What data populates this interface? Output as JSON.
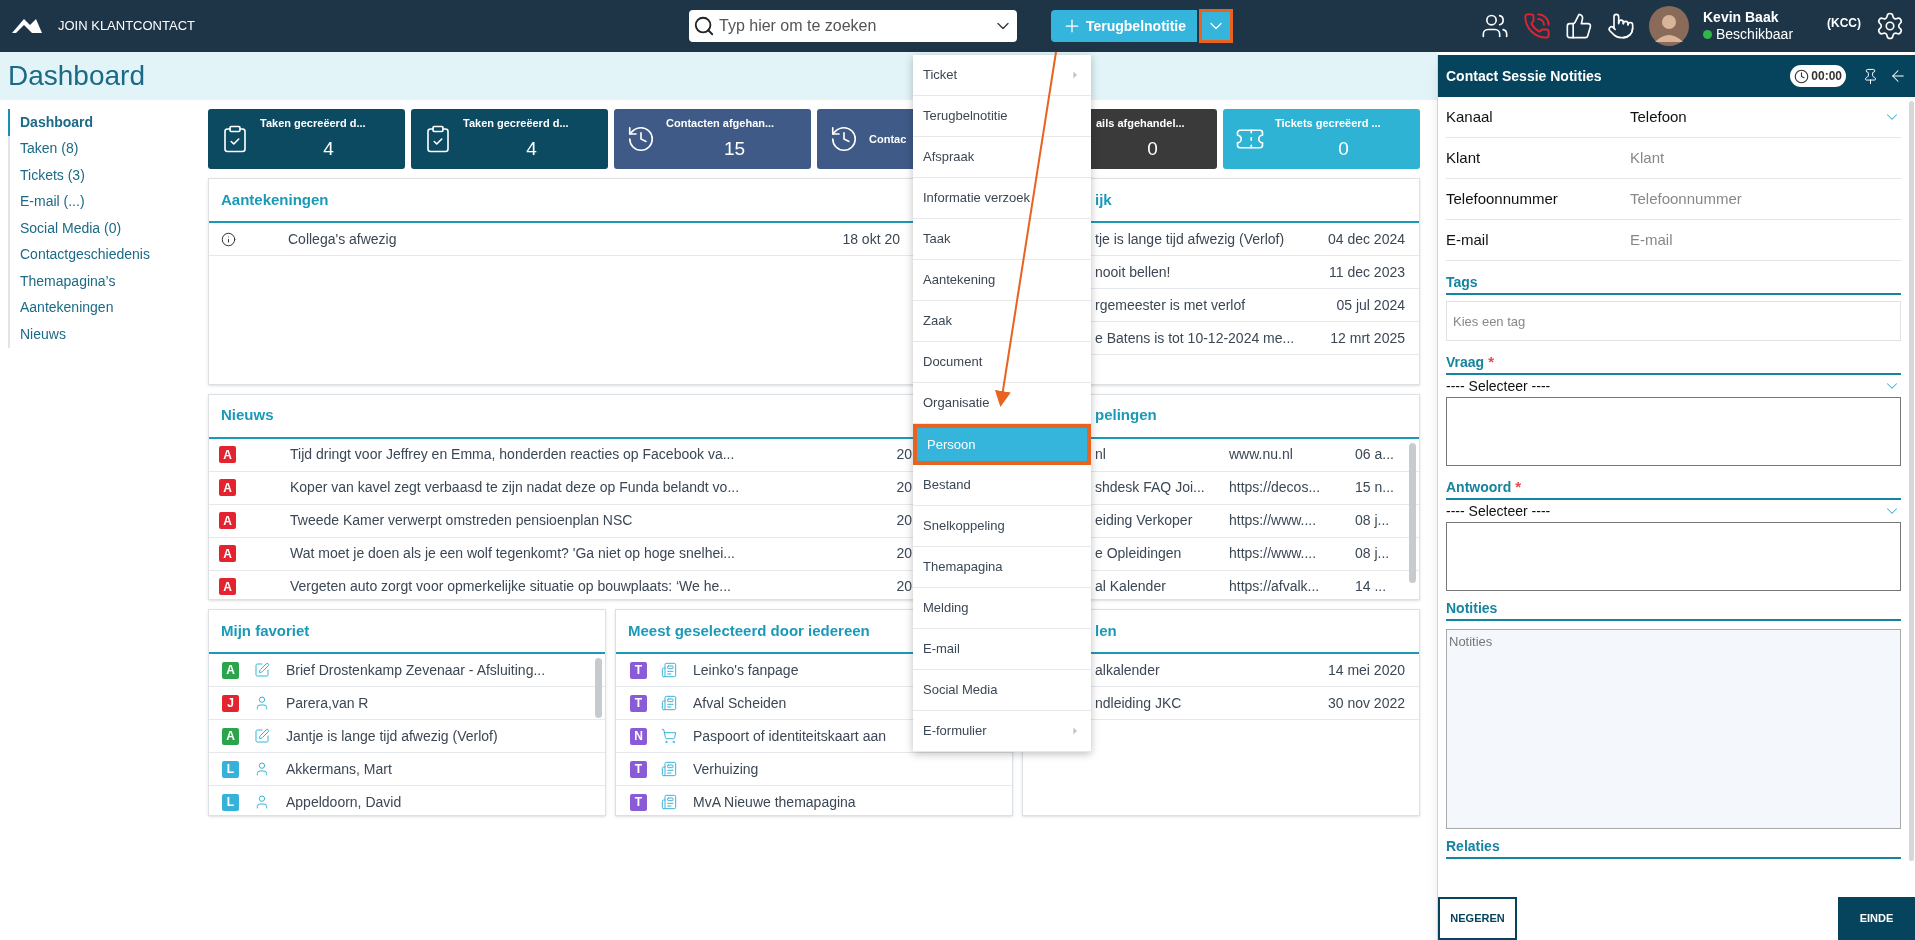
{
  "app": {
    "title": "JOIN KLANTCONTACT"
  },
  "search": {
    "placeholder": "Typ hier om te zoeken"
  },
  "new_button": {
    "label": "Terugbelnotitie",
    "expanded": true
  },
  "user": {
    "name": "Kevin Baak",
    "status": "Beschikbaar",
    "available": true,
    "role": "(KCC)"
  },
  "page_title": "Dashboard",
  "nav": [
    {
      "label": "Dashboard",
      "selected": true
    },
    {
      "label": "Taken (8)",
      "selected": false
    },
    {
      "label": "Tickets (3)",
      "selected": false
    },
    {
      "label": "E-mail (...)",
      "selected": false
    },
    {
      "label": "Social Media (0)",
      "selected": false
    },
    {
      "label": "Contactgeschiedenis",
      "selected": false
    },
    {
      "label": "Themapagina’s",
      "selected": false
    },
    {
      "label": "Aantekeningen",
      "selected": false
    },
    {
      "label": "Nieuws",
      "selected": false
    }
  ],
  "stats": [
    {
      "title": "Taken gecreëerd d...",
      "value": "4",
      "kind": "task",
      "color": "#0c4a62"
    },
    {
      "title": "Taken gecreëerd d...",
      "value": "4",
      "kind": "task",
      "color": "#0c4a62"
    },
    {
      "title": "Contacten afgehan...",
      "value": "15",
      "kind": "contact",
      "color": "#3f5a86"
    },
    {
      "title": "Contac",
      "kind": "contact",
      "color": "#3f5a86"
    },
    {
      "title": "ails afgehandel...",
      "value": "0",
      "color": "#3a3a3a"
    },
    {
      "title": "Tickets gecreëerd ...",
      "value": "0",
      "kind": "ticket",
      "color": "#2fb3d4"
    }
  ],
  "notes_panel": {
    "title": "Aantekeningen",
    "rows": [
      {
        "text": "Collega's afwezig",
        "date": "18 okt 20"
      }
    ]
  },
  "news_panel": {
    "title": "Nieuws",
    "rows": [
      {
        "badge": "A",
        "color": "#e3242f",
        "text": "Tijd dringt voor Jeffrey en Emma, honderden reacties op Facebook va...",
        "date": "20"
      },
      {
        "badge": "A",
        "color": "#e3242f",
        "text": "Koper van kavel zegt verbaasd te zijn nadat deze op Funda belandt vo...",
        "date": "20"
      },
      {
        "badge": "A",
        "color": "#e3242f",
        "text": "Tweede Kamer verwerpt omstreden pensioenplan NSC",
        "date": "20"
      },
      {
        "badge": "A",
        "color": "#e3242f",
        "text": "Wat moet je doen als je een wolf tegenkomt? 'Ga niet op hoge snelhei...",
        "date": "20"
      },
      {
        "badge": "A",
        "color": "#e3242f",
        "text": "Vergeten auto zorgt voor opmerkelijke situatie op bouwplaats: ‘We he...",
        "date": "20"
      }
    ]
  },
  "favorites_panel": {
    "title": "Mijn favoriet",
    "rows": [
      {
        "badge": "A",
        "color": "#2ca44c",
        "kind": "note",
        "text": "Brief Drostenkamp Zevenaar - Afsluiting..."
      },
      {
        "badge": "J",
        "color": "#e3242f",
        "kind": "person",
        "text": "Parera,van R"
      },
      {
        "badge": "A",
        "color": "#2ca44c",
        "kind": "note",
        "text": "Jantje is lange tijd afwezig (Verlof)"
      },
      {
        "badge": "L",
        "color": "#36b2d9",
        "kind": "person",
        "text": "Akkermans, Mart"
      },
      {
        "badge": "L",
        "color": "#36b2d9",
        "kind": "person",
        "text": "Appeldoorn, David"
      }
    ]
  },
  "popular_panel": {
    "title": "Meest geselecteerd door iedereen",
    "rows": [
      {
        "badge": "T",
        "color": "#8a5bd6",
        "kind": "page",
        "text": "Leinko's fanpage"
      },
      {
        "badge": "T",
        "color": "#8a5bd6",
        "kind": "page",
        "text": "Afval Scheiden"
      },
      {
        "badge": "N",
        "color": "#8a5bd6",
        "kind": "product",
        "text": "Paspoort of identiteitskaart aan"
      },
      {
        "badge": "T",
        "color": "#8a5bd6",
        "kind": "page",
        "text": "Verhuizing"
      },
      {
        "badge": "T",
        "color": "#8a5bd6",
        "kind": "page",
        "text": "MvA Nieuwe themapagina"
      }
    ]
  },
  "column_3_top": {
    "title": "ijk",
    "rows": [
      {
        "text": "tje is lange tijd afwezig (Verlof)",
        "date": "04 dec 2024"
      },
      {
        "text": "nooit bellen!",
        "date": "11 dec 2023"
      },
      {
        "text": "rgemeester is met verlof",
        "date": "05 jul 2024"
      },
      {
        "text": "e Batens is tot 10-12-2024 me...",
        "date": "12 mrt 2025"
      }
    ]
  },
  "column_3_middle": {
    "title": "pelingen",
    "rows": [
      {
        "text": "nl",
        "url": "www.nu.nl",
        "date": "06 a..."
      },
      {
        "text": "shdesk FAQ Joi...",
        "url": "https://decos...",
        "date": "15 n..."
      },
      {
        "text": "eiding Verkoper",
        "url": "https://www....",
        "date": "08 j..."
      },
      {
        "text": "e Opleidingen",
        "url": "https://www....",
        "date": "08 j..."
      },
      {
        "text": "al Kalender",
        "url": "https://afvalk...",
        "date": "14 ..."
      }
    ]
  },
  "column_3_bottom": {
    "title": "len",
    "rows": [
      {
        "text": "alkalender",
        "date": "14 mei 2020"
      },
      {
        "text": "ndleiding JKC",
        "date": "30 nov 2022"
      }
    ]
  },
  "menu": {
    "items": [
      {
        "label": "Ticket",
        "selected": false,
        "submenu": true
      },
      {
        "label": "Terugbelnotitie",
        "selected": false,
        "submenu": false
      },
      {
        "label": "Afspraak",
        "selected": false,
        "submenu": false
      },
      {
        "label": "Informatie verzoek",
        "selected": false,
        "submenu": false
      },
      {
        "label": "Taak",
        "selected": false,
        "submenu": false
      },
      {
        "label": "Aantekening",
        "selected": false,
        "submenu": false
      },
      {
        "label": "Zaak",
        "selected": false,
        "submenu": false
      },
      {
        "label": "Document",
        "selected": false,
        "submenu": false
      },
      {
        "label": "Organisatie",
        "selected": false,
        "submenu": false
      },
      {
        "label": "Persoon",
        "selected": true,
        "submenu": false
      },
      {
        "label": "Bestand",
        "selected": false,
        "submenu": false
      },
      {
        "label": "Snelkoppeling",
        "selected": false,
        "submenu": false
      },
      {
        "label": "Themapagina",
        "selected": false,
        "submenu": false
      },
      {
        "label": "Melding",
        "selected": false,
        "submenu": false
      },
      {
        "label": "E-mail",
        "selected": false,
        "submenu": false
      },
      {
        "label": "Social Media",
        "selected": false,
        "submenu": false
      },
      {
        "label": "E-formulier",
        "selected": false,
        "submenu": true
      }
    ]
  },
  "session": {
    "title": "Contact Sessie Notities",
    "timer": "00:00",
    "fields": [
      {
        "label": "Kanaal",
        "kind": "select",
        "value": "Telefoon"
      },
      {
        "label": "Klant",
        "kind": "text",
        "placeholder": "Klant"
      },
      {
        "label": "Telefoonnummer",
        "kind": "text",
        "placeholder": "Telefoonnummer"
      },
      {
        "label": "E-mail",
        "kind": "text",
        "placeholder": "E-mail"
      }
    ],
    "tags": {
      "title": "Tags",
      "placeholder": "Kies een tag"
    },
    "questions": [
      {
        "title": "Vraag",
        "required_mark": "*",
        "select": "---- Selecteer ----"
      },
      {
        "title": "Antwoord",
        "required_mark": "*",
        "select": "---- Selecteer ----"
      }
    ],
    "notes": {
      "title": "Notities",
      "placeholder": "Notities"
    },
    "relations": {
      "title": "Relaties"
    },
    "buttons": [
      {
        "label": "NEGEREN",
        "kind": "outline"
      },
      {
        "label": "EINDE",
        "kind": "primary"
      }
    ]
  }
}
